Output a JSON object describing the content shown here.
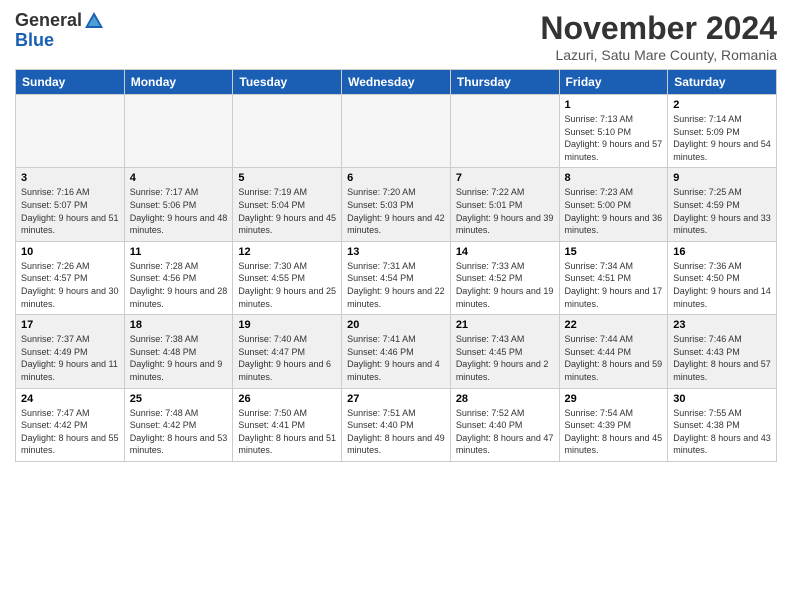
{
  "header": {
    "logo_general": "General",
    "logo_blue": "Blue",
    "month_title": "November 2024",
    "location": "Lazuri, Satu Mare County, Romania"
  },
  "weekdays": [
    "Sunday",
    "Monday",
    "Tuesday",
    "Wednesday",
    "Thursday",
    "Friday",
    "Saturday"
  ],
  "weeks": [
    [
      {
        "day": "",
        "info": "",
        "empty": true
      },
      {
        "day": "",
        "info": "",
        "empty": true
      },
      {
        "day": "",
        "info": "",
        "empty": true
      },
      {
        "day": "",
        "info": "",
        "empty": true
      },
      {
        "day": "",
        "info": "",
        "empty": true
      },
      {
        "day": "1",
        "info": "Sunrise: 7:13 AM\nSunset: 5:10 PM\nDaylight: 9 hours and 57 minutes."
      },
      {
        "day": "2",
        "info": "Sunrise: 7:14 AM\nSunset: 5:09 PM\nDaylight: 9 hours and 54 minutes."
      }
    ],
    [
      {
        "day": "3",
        "info": "Sunrise: 7:16 AM\nSunset: 5:07 PM\nDaylight: 9 hours and 51 minutes."
      },
      {
        "day": "4",
        "info": "Sunrise: 7:17 AM\nSunset: 5:06 PM\nDaylight: 9 hours and 48 minutes."
      },
      {
        "day": "5",
        "info": "Sunrise: 7:19 AM\nSunset: 5:04 PM\nDaylight: 9 hours and 45 minutes."
      },
      {
        "day": "6",
        "info": "Sunrise: 7:20 AM\nSunset: 5:03 PM\nDaylight: 9 hours and 42 minutes."
      },
      {
        "day": "7",
        "info": "Sunrise: 7:22 AM\nSunset: 5:01 PM\nDaylight: 9 hours and 39 minutes."
      },
      {
        "day": "8",
        "info": "Sunrise: 7:23 AM\nSunset: 5:00 PM\nDaylight: 9 hours and 36 minutes."
      },
      {
        "day": "9",
        "info": "Sunrise: 7:25 AM\nSunset: 4:59 PM\nDaylight: 9 hours and 33 minutes."
      }
    ],
    [
      {
        "day": "10",
        "info": "Sunrise: 7:26 AM\nSunset: 4:57 PM\nDaylight: 9 hours and 30 minutes."
      },
      {
        "day": "11",
        "info": "Sunrise: 7:28 AM\nSunset: 4:56 PM\nDaylight: 9 hours and 28 minutes."
      },
      {
        "day": "12",
        "info": "Sunrise: 7:30 AM\nSunset: 4:55 PM\nDaylight: 9 hours and 25 minutes."
      },
      {
        "day": "13",
        "info": "Sunrise: 7:31 AM\nSunset: 4:54 PM\nDaylight: 9 hours and 22 minutes."
      },
      {
        "day": "14",
        "info": "Sunrise: 7:33 AM\nSunset: 4:52 PM\nDaylight: 9 hours and 19 minutes."
      },
      {
        "day": "15",
        "info": "Sunrise: 7:34 AM\nSunset: 4:51 PM\nDaylight: 9 hours and 17 minutes."
      },
      {
        "day": "16",
        "info": "Sunrise: 7:36 AM\nSunset: 4:50 PM\nDaylight: 9 hours and 14 minutes."
      }
    ],
    [
      {
        "day": "17",
        "info": "Sunrise: 7:37 AM\nSunset: 4:49 PM\nDaylight: 9 hours and 11 minutes."
      },
      {
        "day": "18",
        "info": "Sunrise: 7:38 AM\nSunset: 4:48 PM\nDaylight: 9 hours and 9 minutes."
      },
      {
        "day": "19",
        "info": "Sunrise: 7:40 AM\nSunset: 4:47 PM\nDaylight: 9 hours and 6 minutes."
      },
      {
        "day": "20",
        "info": "Sunrise: 7:41 AM\nSunset: 4:46 PM\nDaylight: 9 hours and 4 minutes."
      },
      {
        "day": "21",
        "info": "Sunrise: 7:43 AM\nSunset: 4:45 PM\nDaylight: 9 hours and 2 minutes."
      },
      {
        "day": "22",
        "info": "Sunrise: 7:44 AM\nSunset: 4:44 PM\nDaylight: 8 hours and 59 minutes."
      },
      {
        "day": "23",
        "info": "Sunrise: 7:46 AM\nSunset: 4:43 PM\nDaylight: 8 hours and 57 minutes."
      }
    ],
    [
      {
        "day": "24",
        "info": "Sunrise: 7:47 AM\nSunset: 4:42 PM\nDaylight: 8 hours and 55 minutes."
      },
      {
        "day": "25",
        "info": "Sunrise: 7:48 AM\nSunset: 4:42 PM\nDaylight: 8 hours and 53 minutes."
      },
      {
        "day": "26",
        "info": "Sunrise: 7:50 AM\nSunset: 4:41 PM\nDaylight: 8 hours and 51 minutes."
      },
      {
        "day": "27",
        "info": "Sunrise: 7:51 AM\nSunset: 4:40 PM\nDaylight: 8 hours and 49 minutes."
      },
      {
        "day": "28",
        "info": "Sunrise: 7:52 AM\nSunset: 4:40 PM\nDaylight: 8 hours and 47 minutes."
      },
      {
        "day": "29",
        "info": "Sunrise: 7:54 AM\nSunset: 4:39 PM\nDaylight: 8 hours and 45 minutes."
      },
      {
        "day": "30",
        "info": "Sunrise: 7:55 AM\nSunset: 4:38 PM\nDaylight: 8 hours and 43 minutes."
      }
    ]
  ]
}
